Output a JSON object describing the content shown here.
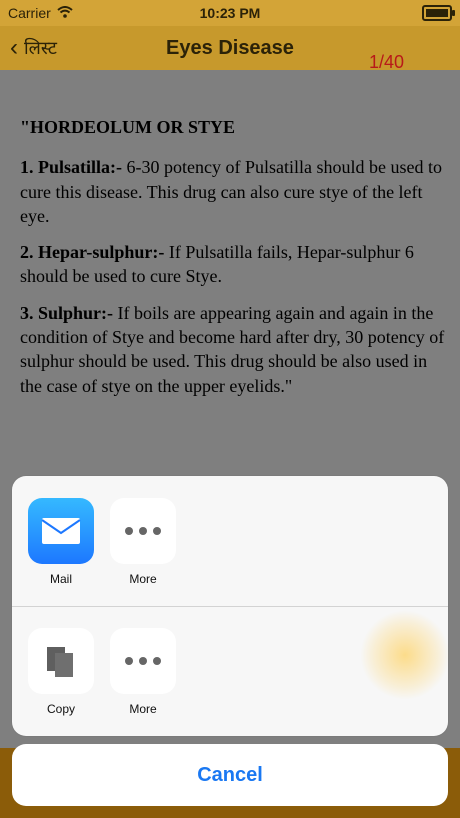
{
  "status": {
    "carrier": "Carrier",
    "time": "10:23 PM"
  },
  "nav": {
    "back_label": "लिस्ट",
    "title": "Eyes Disease",
    "counter": "1/40"
  },
  "article": {
    "heading": "\"HORDEOLUM OR STYE",
    "paragraphs": [
      {
        "title": "1. Pulsatilla:-",
        "text": " 6-30 potency of Pulsatilla should be used to cure this disease. This drug can also cure stye of the left eye."
      },
      {
        "title": "2. Hepar-sulphur:-",
        "text": " If Pulsatilla fails, Hepar-sulphur 6 should be used to cure Stye."
      },
      {
        "title": "3. Sulphur:-",
        "text": " If boils are appearing again and again in the condition of Stye and become hard after dry, 30 potency of sulphur should be used. This drug should be also used in the case of stye on the upper eyelids.\""
      }
    ]
  },
  "share_sheet": {
    "row1": [
      {
        "label": "Mail",
        "icon": "mail-icon"
      },
      {
        "label": "More",
        "icon": "more-icon"
      }
    ],
    "row2": [
      {
        "label": "Copy",
        "icon": "copy-icon"
      },
      {
        "label": "More",
        "icon": "more-icon"
      }
    ],
    "cancel_label": "Cancel"
  }
}
